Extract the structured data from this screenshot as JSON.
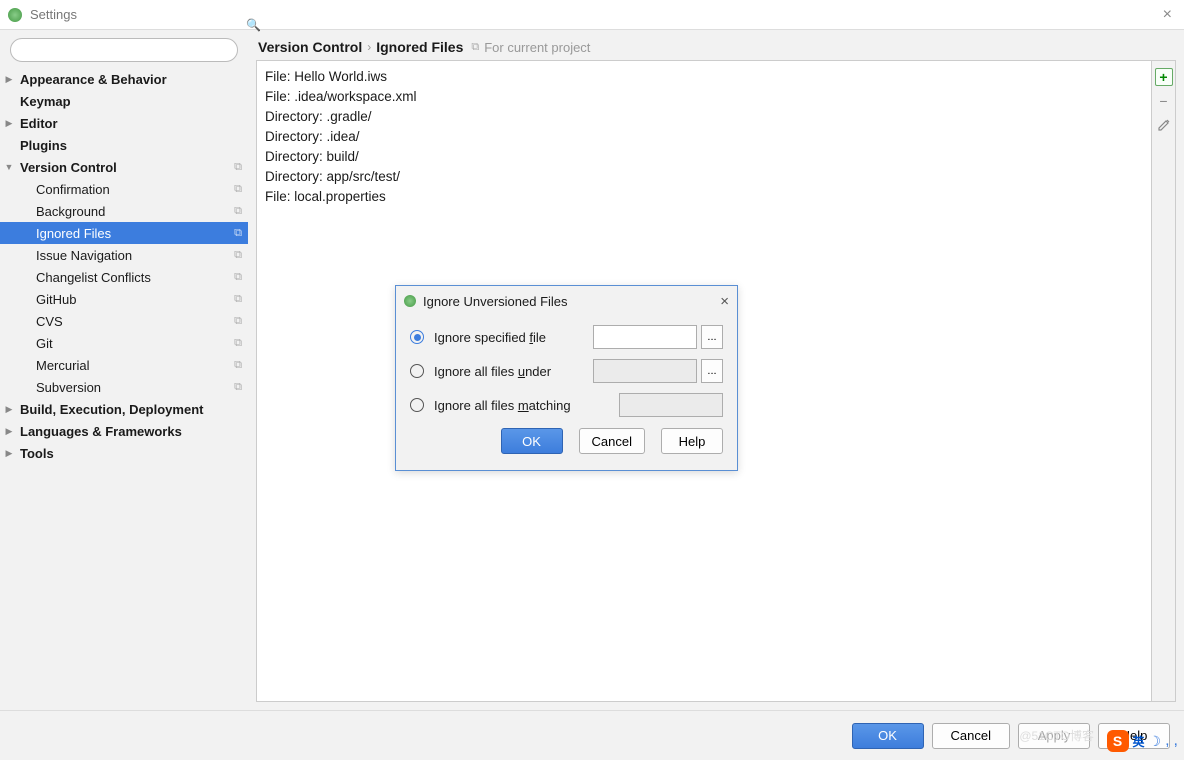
{
  "window": {
    "title": "Settings"
  },
  "search": {
    "placeholder": ""
  },
  "tree": [
    {
      "label": "Appearance & Behavior",
      "level": 0,
      "expandable": true,
      "expanded": false,
      "bold": true
    },
    {
      "label": "Keymap",
      "level": 0,
      "expandable": false,
      "bold": true
    },
    {
      "label": "Editor",
      "level": 0,
      "expandable": true,
      "expanded": false,
      "bold": true
    },
    {
      "label": "Plugins",
      "level": 0,
      "expandable": false,
      "bold": true
    },
    {
      "label": "Version Control",
      "level": 0,
      "expandable": true,
      "expanded": true,
      "bold": true,
      "copy": true
    },
    {
      "label": "Confirmation",
      "level": 1,
      "copy": true
    },
    {
      "label": "Background",
      "level": 1,
      "copy": true
    },
    {
      "label": "Ignored Files",
      "level": 1,
      "selected": true,
      "copy": true
    },
    {
      "label": "Issue Navigation",
      "level": 1,
      "copy": true
    },
    {
      "label": "Changelist Conflicts",
      "level": 1,
      "copy": true
    },
    {
      "label": "GitHub",
      "level": 1,
      "copy": true
    },
    {
      "label": "CVS",
      "level": 1,
      "copy": true
    },
    {
      "label": "Git",
      "level": 1,
      "copy": true
    },
    {
      "label": "Mercurial",
      "level": 1,
      "copy": true
    },
    {
      "label": "Subversion",
      "level": 1,
      "copy": true
    },
    {
      "label": "Build, Execution, Deployment",
      "level": 0,
      "expandable": true,
      "bold": true
    },
    {
      "label": "Languages & Frameworks",
      "level": 0,
      "expandable": true,
      "bold": true
    },
    {
      "label": "Tools",
      "level": 0,
      "expandable": true,
      "bold": true
    }
  ],
  "breadcrumb": {
    "a": "Version Control",
    "b": "Ignored Files",
    "scope": "For current project"
  },
  "ignored_entries": [
    "File: Hello World.iws",
    "File: .idea/workspace.xml",
    "Directory: .gradle/",
    "Directory: .idea/",
    "Directory: build/",
    "Directory: app/src/test/",
    "File: local.properties"
  ],
  "side_buttons": {
    "add": "+",
    "remove": "−",
    "edit": "✎"
  },
  "dialog": {
    "title": "Ignore Unversioned Files",
    "opt1_pre": "Ignore specified ",
    "opt1_u": "f",
    "opt1_post": "ile",
    "opt2_pre": "Ignore all files ",
    "opt2_u": "u",
    "opt2_post": "nder",
    "opt3_pre": "Ignore all files ",
    "opt3_u": "m",
    "opt3_post": "atching",
    "browse": "...",
    "ok": "OK",
    "cancel": "Cancel",
    "help": "Help"
  },
  "footer": {
    "ok": "OK",
    "cancel": "Cancel",
    "apply": "Apply",
    "help": "Help"
  },
  "watermark": "@51CTO博客",
  "ime": {
    "letter": "S",
    "lang": "英"
  }
}
